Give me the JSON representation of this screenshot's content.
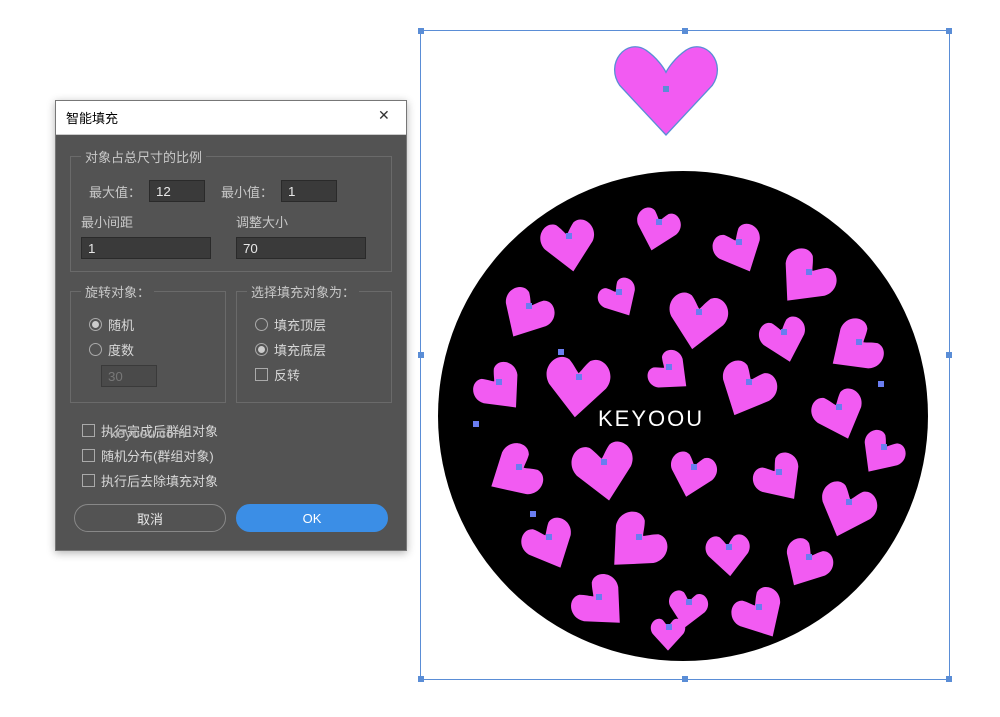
{
  "dialog": {
    "title": "智能填充",
    "ratio": {
      "legend": "对象占总尺寸的比例",
      "max_label": "最大值：",
      "max_value": "12",
      "min_label": "最小值：",
      "min_value": "1",
      "gap_label": "最小间距",
      "gap_value": "1",
      "resize_label": "调整大小",
      "resize_value": "70"
    },
    "rotate": {
      "legend": "旋转对象：",
      "random": "随机",
      "degree": "度数",
      "degree_value": "30",
      "selected": "random"
    },
    "fillTarget": {
      "legend": "选择填充对象为：",
      "top": "填充顶层",
      "bottom": "填充底层",
      "invert": "反转",
      "selected": "bottom"
    },
    "checks": {
      "group_after": "执行完成后群组对象",
      "random_distribute": "随机分布(群组对象)",
      "remove_fill_after": "执行后去除填充对象"
    },
    "buttons": {
      "cancel": "取消",
      "ok": "OK"
    }
  },
  "canvas": {
    "brand": "KEYOOU",
    "watermark": "keyoou.com",
    "heart_fill": "#f25bf2",
    "heart_stroke": "#5a8dd6",
    "dot_color": "#6a7df0",
    "circle_fill": "#000000"
  }
}
